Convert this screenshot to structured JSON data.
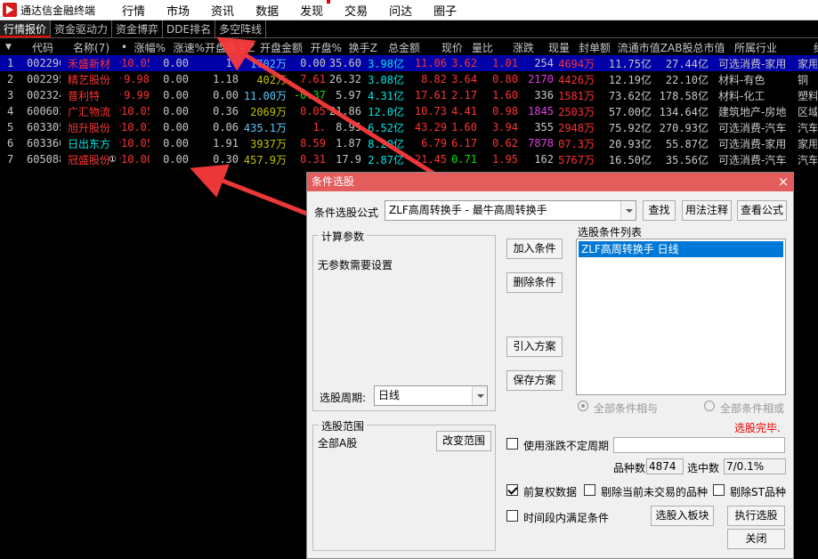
{
  "app": {
    "title": "通达信金融终端"
  },
  "menu": [
    "行情",
    "市场",
    "资讯",
    "数据",
    "发现",
    "交易",
    "问达",
    "圈子"
  ],
  "tabs": [
    "行情报价",
    "资金驱动力",
    "资金博弈",
    "DDE排名",
    "多空阵线"
  ],
  "columns": [
    "",
    "代码",
    "名称(7)",
    "•",
    "涨幅%",
    "涨速%",
    "开盘换手Z",
    "开盘金额",
    "开盘%",
    "换手Z",
    "总金额",
    "现价",
    "量比",
    "涨跌",
    "现量",
    "封单额",
    "流通市值Z",
    "AB股总市值",
    "所属行业",
    "细分"
  ],
  "rows": [
    {
      "idx": "1",
      "code": "002290",
      "name": "禾盛新材",
      "pct": "10.05",
      "speed": "0.00",
      "oturn": "1.",
      "oamt": "1702万",
      "opct": "0.00",
      "turn": "35.60",
      "amt": "3.98亿",
      "price": "11.06",
      "vr": "3.62",
      "chg": "1.01",
      "vol": "254",
      "seal": "4694万",
      "mcap": "11.75亿",
      "tcap": "27.44亿",
      "ind": "可选消费-家用",
      "sub": "家用"
    },
    {
      "idx": "2",
      "code": "002295",
      "name": "精艺股份",
      "pct": "9.98",
      "speed": "0.00",
      "oturn": "1.18",
      "oamt": "402万",
      "opct": "7.61",
      "turn": "26.32",
      "amt": "3.08亿",
      "price": "8.82",
      "vr": "3.64",
      "chg": "0.80",
      "vol": "2170",
      "seal": "4426万",
      "mcap": "12.19亿",
      "tcap": "22.10亿",
      "ind": "材料-有色",
      "sub": "铜"
    },
    {
      "idx": "3",
      "code": "002324",
      "name": "普利特",
      "pct": "9.99",
      "speed": "0.00",
      "oturn": "0.00",
      "oamt": "11.00万",
      "opct": "-0.37",
      "turn": "5.97",
      "amt": "4.31亿",
      "price": "17.61",
      "vr": "2.17",
      "chg": "1.60",
      "vol": "336",
      "seal": "1581万",
      "mcap": "73.62亿",
      "tcap": "178.58亿",
      "ind": "材料-化工",
      "sub": "塑料"
    },
    {
      "idx": "4",
      "code": "600603",
      "name": "广汇物流",
      "pct": "10.05",
      "speed": "0.00",
      "oturn": "0.36",
      "oamt": "2069万",
      "opct": "0.05",
      "turn": "21.86",
      "amt": "12.0亿",
      "price": "10.73",
      "vr": "4.41",
      "chg": "0.98",
      "vol": "1845",
      "seal": "2503万",
      "mcap": "57.00亿",
      "tcap": "134.64亿",
      "ind": "建筑地产-房地",
      "sub": "区域"
    },
    {
      "idx": "5",
      "code": "603305",
      "name": "旭升股份",
      "pct": "10.01",
      "speed": "0.00",
      "oturn": "0.06",
      "oamt": "435.1万",
      "opct": "1.",
      "turn": "8.95",
      "amt": "6.52亿",
      "price": "43.29",
      "vr": "1.60",
      "chg": "3.94",
      "vol": "355",
      "seal": "2948万",
      "mcap": "75.92亿",
      "tcap": "270.93亿",
      "ind": "可选消费-汽车",
      "sub": "汽车"
    },
    {
      "idx": "6",
      "code": "603366",
      "name": "日出东方",
      "pct": "10.05",
      "speed": "0.00",
      "oturn": "1.91",
      "oamt": "3937万",
      "opct": "8.59",
      "turn": "1.87",
      "amt": "8.20亿",
      "price": "6.79",
      "vr": "6.17",
      "chg": "0.62",
      "vol": "7878",
      "seal": "07.3万",
      "mcap": "20.93亿",
      "tcap": "55.87亿",
      "ind": "可选消费-家用",
      "sub": "家用"
    },
    {
      "idx": "7",
      "code": "605088",
      "name": "冠盛股份",
      "pct": "10.00",
      "speed": "0.00",
      "oturn": "0.30",
      "oamt": "457.9万",
      "opct": "0.31",
      "turn": "17.9",
      "amt": "2.87亿",
      "price": "21.45",
      "vr": "0.71",
      "chg": "1.95",
      "vol": "162",
      "seal": "5767万",
      "mcap": "16.50亿",
      "tcap": "35.56亿",
      "ind": "可选消费-汽车",
      "sub": "汽车"
    }
  ],
  "badge": "①",
  "dialog": {
    "title": "条件选股",
    "close": "×",
    "formula_label": "条件选股公式",
    "formula_value": "ZLF高周转换手 - 最牛高周转换手",
    "find": "查找",
    "usage": "用法注释",
    "view_formula": "查看公式",
    "params_title": "计算参数",
    "params_text": "无参数需要设置",
    "add_cond": "加入条件",
    "del_cond": "删除条件",
    "import_plan": "引入方案",
    "save_plan": "保存方案",
    "list_title": "选股条件列表",
    "list_item": "ZLF高周转换手  日线",
    "all_and": "全部条件相与",
    "all_or": "全部条件相或",
    "period_label": "选股周期:",
    "period_value": "日线",
    "done": "选股完毕.",
    "range_title": "选股范围",
    "range_value": "全部A股",
    "change_range": "改变范围",
    "use_uncertain": "使用涨跌不定周期",
    "count_label": "品种数",
    "count_value": "4874",
    "selected_label": "选中数",
    "selected_value": "7/0.1%",
    "pre_adjust": "前复权数据",
    "exclude_no_trade": "剔除当前未交易的品种",
    "exclude_st": "剔除ST品种",
    "time_satisfy": "时间段内满足条件",
    "to_board": "选股入板块",
    "execute": "执行选股",
    "close_btn": "关闭"
  },
  "colors": {
    "annotation_arrow": "#ff3c3c",
    "dialog_title": "#e45d5d",
    "selection": "#0000a8"
  }
}
